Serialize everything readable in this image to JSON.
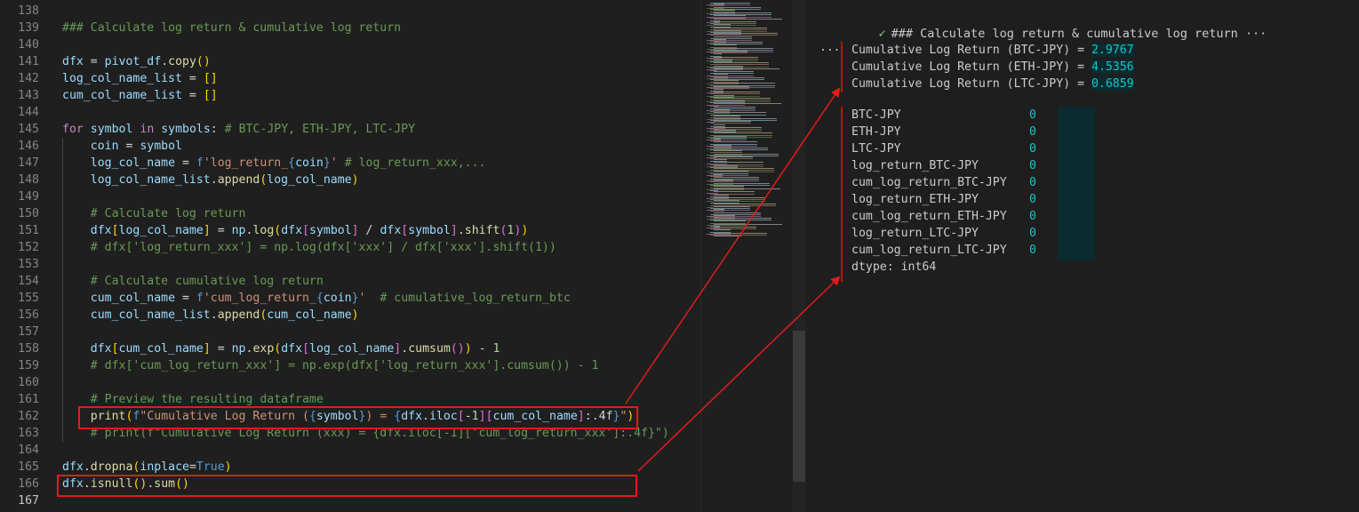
{
  "editor": {
    "lines": [
      {
        "n": "138",
        "html": ""
      },
      {
        "n": "139",
        "html": "<span class='c'>### Calculate log return &amp; cumulative log return</span>"
      },
      {
        "n": "140",
        "html": ""
      },
      {
        "n": "141",
        "html": "<span class='v'>dfx</span> = <span class='v'>pivot_df</span>.<span class='f'>copy</span><span class='y'>()</span>"
      },
      {
        "n": "142",
        "html": "<span class='v'>log_col_name_list</span> = <span class='y'>[]</span>"
      },
      {
        "n": "143",
        "html": "<span class='v'>cum_col_name_list</span> = <span class='y'>[]</span>"
      },
      {
        "n": "144",
        "html": ""
      },
      {
        "n": "145",
        "html": "<span class='k'>for</span> <span class='v'>symbol</span> <span class='k'>in</span> <span class='v'>symbols</span>: <span class='c'># BTC-JPY, ETH-JPY, LTC-JPY</span>"
      },
      {
        "n": "146",
        "html": "    <span class='v'>coin</span> = <span class='v'>symbol</span>"
      },
      {
        "n": "147",
        "html": "    <span class='v'>log_col_name</span> = <span class='b'>f</span><span class='s'>'log_return_</span><span class='b'>{</span><span class='v'>coin</span><span class='b'>}</span><span class='s'>'</span> <span class='c'># log_return_xxx,...</span>"
      },
      {
        "n": "148",
        "html": "    <span class='v'>log_col_name_list</span>.<span class='f'>append</span><span class='y'>(</span><span class='v'>log_col_name</span><span class='y'>)</span>"
      },
      {
        "n": "149",
        "html": ""
      },
      {
        "n": "150",
        "html": "    <span class='c'># Calculate log return</span>"
      },
      {
        "n": "151",
        "html": "    <span class='v'>dfx</span><span class='y'>[</span><span class='v'>log_col_name</span><span class='y'>]</span> = <span class='v'>np</span>.<span class='f'>log</span><span class='y'>(</span><span class='v'>dfx</span><span class='p'>[</span><span class='v'>symbol</span><span class='p'>]</span> / <span class='v'>dfx</span><span class='p'>[</span><span class='v'>symbol</span><span class='p'>]</span>.<span class='f'>shift</span><span class='p'>(</span><span class='n'>1</span><span class='p'>)</span><span class='y'>)</span>"
      },
      {
        "n": "152",
        "html": "    <span class='c'># dfx['log_return_xxx'] = np.log(dfx['xxx'] / dfx['xxx'].shift(1))</span>"
      },
      {
        "n": "153",
        "html": ""
      },
      {
        "n": "154",
        "html": "    <span class='c'># Calculate cumulative log return</span>"
      },
      {
        "n": "155",
        "html": "    <span class='v'>cum_col_name</span> = <span class='b'>f</span><span class='s'>'cum_log_return_</span><span class='b'>{</span><span class='v'>coin</span><span class='b'>}</span><span class='s'>'</span>  <span class='c'># cumulative_log_return_btc</span>"
      },
      {
        "n": "156",
        "html": "    <span class='v'>cum_col_name_list</span>.<span class='f'>append</span><span class='y'>(</span><span class='v'>cum_col_name</span><span class='y'>)</span>"
      },
      {
        "n": "157",
        "html": ""
      },
      {
        "n": "158",
        "html": "    <span class='v'>dfx</span><span class='y'>[</span><span class='v'>cum_col_name</span><span class='y'>]</span> = <span class='v'>np</span>.<span class='f'>exp</span><span class='y'>(</span><span class='v'>dfx</span><span class='p'>[</span><span class='v'>log_col_name</span><span class='p'>]</span>.<span class='f'>cumsum</span><span class='p'>()</span><span class='y'>)</span> - <span class='n'>1</span>"
      },
      {
        "n": "159",
        "html": "    <span class='c'># dfx['cum_log_return_xxx'] = np.exp(dfx['log_return_xxx'].cumsum()) - 1</span>"
      },
      {
        "n": "160",
        "html": ""
      },
      {
        "n": "161",
        "html": "    <span class='c'># Preview the resulting dataframe</span>"
      },
      {
        "n": "162",
        "html": "    <span class='f'>print</span><span class='y'>(</span><span class='b'>f</span><span class='s'>\"Cumulative Log Return (</span><span class='b'>{</span><span class='v'>symbol</span><span class='b'>}</span><span class='s'>) = </span><span class='b'>{</span><span class='v'>dfx</span>.<span class='v'>iloc</span><span class='p'>[</span>-<span class='n'>1</span><span class='p'>]</span><span class='p'>[</span><span class='v'>cum_col_name</span><span class='p'>]</span>:.4f<span class='b'>}</span><span class='s'>\"</span><span class='y'>)</span>"
      },
      {
        "n": "163",
        "html": "    <span class='c'># print(f\"Cumulative Log Return (xxx) = {dfx.iloc[-1]['cum_log_return_xxx']:.4f}\")</span>"
      },
      {
        "n": "164",
        "html": ""
      },
      {
        "n": "165",
        "html": "<span class='v'>dfx</span>.<span class='f'>dropna</span><span class='y'>(</span><span class='v'>inplace</span>=<span class='b'>True</span><span class='y'>)</span>"
      },
      {
        "n": "166",
        "html": "<span class='v'>dfx</span>.<span class='f'>isnull</span><span class='y'>()</span>.<span class='f'>sum</span><span class='y'>()</span>"
      },
      {
        "n": "167",
        "html": ""
      }
    ]
  },
  "output": {
    "cell_status": "### Calculate log return & cumulative log return ···",
    "more_label": "...",
    "print_lines": [
      {
        "label": "Cumulative Log Return (BTC-JPY) = ",
        "value": "2.9767"
      },
      {
        "label": "Cumulative Log Return (ETH-JPY) = ",
        "value": "4.5356"
      },
      {
        "label": "Cumulative Log Return (LTC-JPY) = ",
        "value": "0.6859"
      }
    ],
    "series": [
      {
        "name": "BTC-JPY",
        "value": "0"
      },
      {
        "name": "ETH-JPY",
        "value": "0"
      },
      {
        "name": "LTC-JPY",
        "value": "0"
      },
      {
        "name": "log_return_BTC-JPY",
        "value": "0"
      },
      {
        "name": "cum_log_return_BTC-JPY",
        "value": "0"
      },
      {
        "name": "log_return_ETH-JPY",
        "value": "0"
      },
      {
        "name": "cum_log_return_ETH-JPY",
        "value": "0"
      },
      {
        "name": "log_return_LTC-JPY",
        "value": "0"
      },
      {
        "name": "cum_log_return_LTC-JPY",
        "value": "0"
      }
    ],
    "dtype": "dtype: int64"
  },
  "colors": {
    "annotation_red": "#e31b1b",
    "output_value": "#13c8c8",
    "success_check": "#89d185"
  }
}
